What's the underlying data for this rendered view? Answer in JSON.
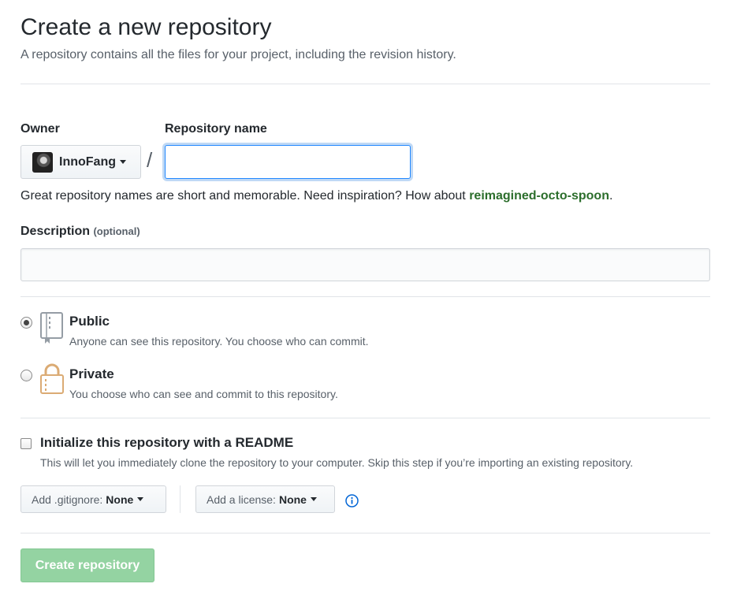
{
  "header": {
    "title": "Create a new repository",
    "subtitle": "A repository contains all the files for your project, including the revision history."
  },
  "owner": {
    "label": "Owner",
    "selected": "InnoFang"
  },
  "repo_name": {
    "label": "Repository name",
    "value": "",
    "separator": "/"
  },
  "hint": {
    "text": "Great repository names are short and memorable. Need inspiration? How about ",
    "suggestion": "reimagined-octo-spoon",
    "end": "."
  },
  "description": {
    "label": "Description",
    "optional": "(optional)",
    "value": ""
  },
  "visibility": {
    "public": {
      "title": "Public",
      "desc": "Anyone can see this repository. You choose who can commit.",
      "checked": true
    },
    "private": {
      "title": "Private",
      "desc": "You choose who can see and commit to this repository.",
      "checked": false
    }
  },
  "init": {
    "title": "Initialize this repository with a README",
    "desc": "This will let you immediately clone the repository to your computer. Skip this step if you’re importing an existing repository.",
    "checked": false
  },
  "gitignore": {
    "label": "Add .gitignore:",
    "value": "None"
  },
  "license": {
    "label": "Add a license:",
    "value": "None"
  },
  "submit": {
    "label": "Create repository"
  },
  "colors": {
    "accent_blue": "#0366d6",
    "submit_disabled": "#94d3a2",
    "suggestion": "#2c6e2c"
  }
}
